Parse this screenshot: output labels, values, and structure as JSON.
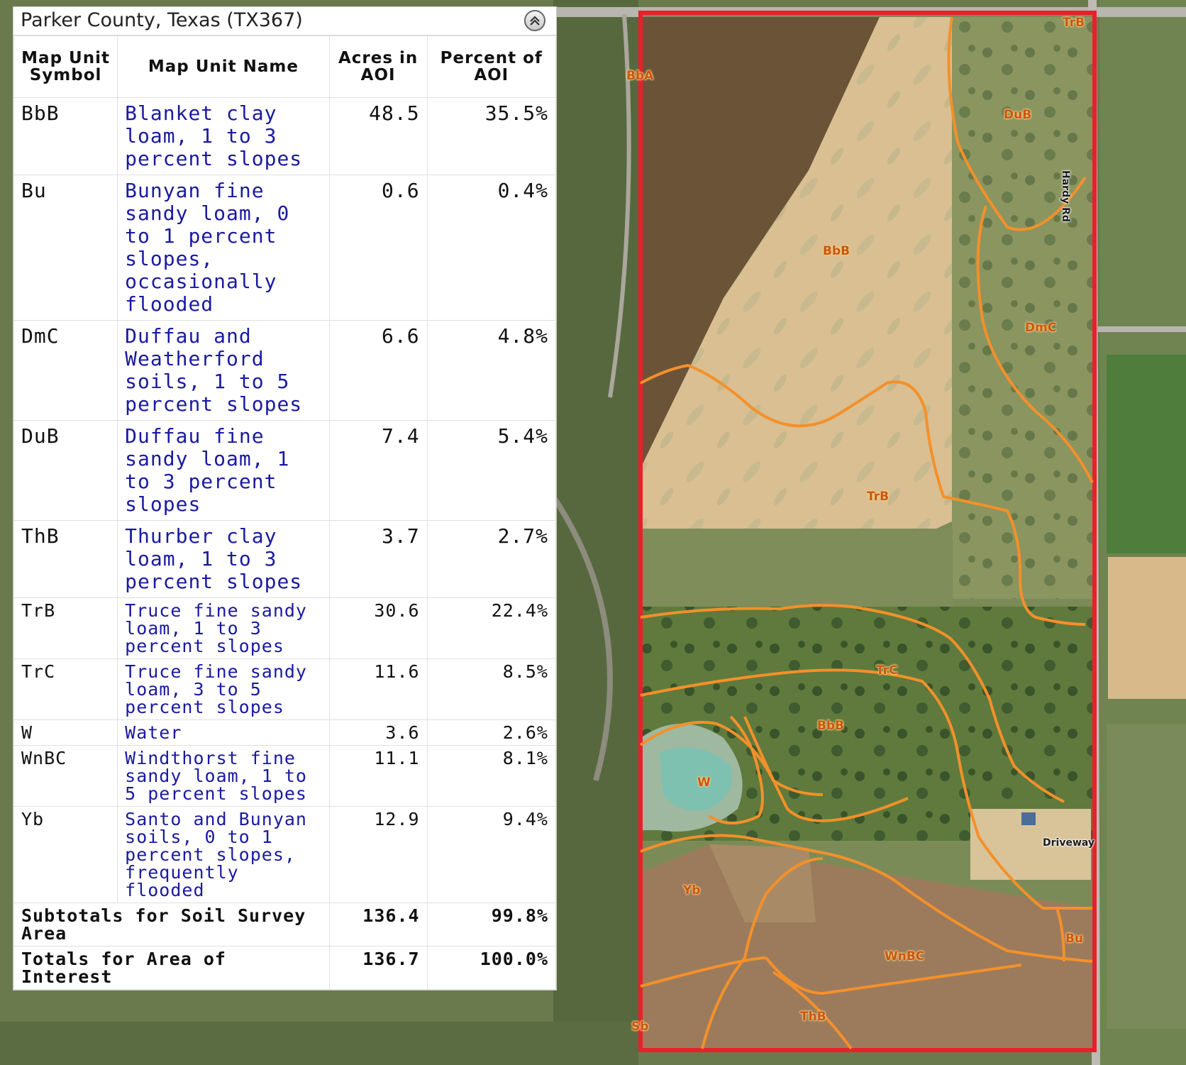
{
  "panel": {
    "title": "Parker County, Texas (TX367)",
    "columns": {
      "symbol": "Map Unit Symbol",
      "name": "Map Unit Name",
      "acres": "Acres in AOI",
      "percent": "Percent of AOI"
    },
    "rows": [
      {
        "symbol": "BbB",
        "name": "Blanket clay loam, 1 to 3 percent slopes",
        "acres": "48.5",
        "percent": "35.5%"
      },
      {
        "symbol": "Bu",
        "name": "Bunyan fine sandy loam, 0 to 1 percent slopes, occasionally flooded",
        "acres": "0.6",
        "percent": "0.4%"
      },
      {
        "symbol": "DmC",
        "name": "Duffau and Weatherford soils, 1 to 5 percent slopes",
        "acres": "6.6",
        "percent": "4.8%"
      },
      {
        "symbol": "DuB",
        "name": "Duffau fine sandy loam, 1 to 3 percent slopes",
        "acres": "7.4",
        "percent": "5.4%"
      },
      {
        "symbol": "ThB",
        "name": "Thurber clay loam, 1 to 3 percent slopes",
        "acres": "3.7",
        "percent": "2.7%"
      },
      {
        "symbol": "TrB",
        "name": "Truce fine sandy loam, 1 to 3 percent slopes",
        "acres": "30.6",
        "percent": "22.4%"
      },
      {
        "symbol": "TrC",
        "name": "Truce fine sandy loam, 3 to 5 percent slopes",
        "acres": "11.6",
        "percent": "8.5%"
      },
      {
        "symbol": "W",
        "name": "Water",
        "acres": "3.6",
        "percent": "2.6%"
      },
      {
        "symbol": "WnBC",
        "name": "Windthorst fine sandy loam, 1 to 5 percent slopes",
        "acres": "11.1",
        "percent": "8.1%"
      },
      {
        "symbol": "Yb",
        "name": "Santo and Bunyan soils, 0 to 1 percent slopes, frequently flooded",
        "acres": "12.9",
        "percent": "9.4%"
      }
    ],
    "subtotal": {
      "label": "Subtotals for Soil Survey Area",
      "acres": "136.4",
      "percent": "99.8%"
    },
    "total": {
      "label": "Totals for Area of Interest",
      "acres": "136.7",
      "percent": "100.0%"
    }
  },
  "map": {
    "labels": {
      "bba": "BbA",
      "trb_top": "TrB",
      "dub": "DuB",
      "bbb_top": "BbB",
      "dmc": "DmC",
      "trb_mid": "TrB",
      "trc": "TrC",
      "bbb_low": "BbB",
      "w": "W",
      "yb": "Yb",
      "bu": "Bu",
      "wnbc": "WnBC",
      "thb": "ThB",
      "sb": "Sb"
    },
    "roads": {
      "hardy": "Hardy Rd",
      "driveway": "Driveway"
    },
    "colors": {
      "aoi_border": "#e8202a",
      "soil_lines": "#f4902a",
      "labels": "#c8580e"
    }
  }
}
